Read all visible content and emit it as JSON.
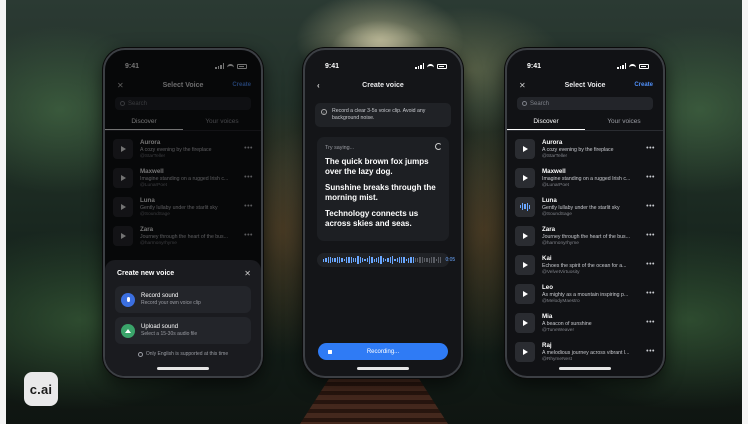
{
  "logo": {
    "text": "c.ai"
  },
  "status": {
    "time": "9:41"
  },
  "select_voice": {
    "title": "Select Voice",
    "close_icon": "close-icon",
    "create_label": "Create",
    "search_placeholder": "Search",
    "tabs": [
      {
        "label": "Discover",
        "active": true
      },
      {
        "label": "Your voices",
        "active": false
      }
    ],
    "voices": [
      {
        "name": "Aurora",
        "desc": "A cozy evening by the fireplace",
        "handle": "@StarTeller"
      },
      {
        "name": "Maxwell",
        "desc": "Imagine standing on a rugged Irish c...",
        "handle": "@LunarPoet"
      },
      {
        "name": "Luna",
        "desc": "Gently lullaby under the starlit sky",
        "handle": "@SoundSage"
      },
      {
        "name": "Zara",
        "desc": "Journey through the heart of the bus...",
        "handle": "@harmonyrhyme"
      },
      {
        "name": "Kai",
        "desc": "Echoes the spirit of the ocean for a...",
        "handle": "@VelvetVirtuosity"
      },
      {
        "name": "Leo",
        "desc": "As mighty as a mountain inspiring p...",
        "handle": "@MelodyMaestro"
      },
      {
        "name": "Mia",
        "desc": "A beacon of sunshine",
        "handle": "@TuneWeaver"
      },
      {
        "name": "Raj",
        "desc": "A melodious journey across vibrant l...",
        "handle": "@RhymeNest"
      }
    ]
  },
  "create_sheet": {
    "title": "Create new voice",
    "options": [
      {
        "title": "Record sound",
        "sub": "Record your own voice clip"
      },
      {
        "title": "Upload sound",
        "sub": "Select a 15-30s audio file"
      }
    ],
    "note": "Only English is supported at this time"
  },
  "create_voice": {
    "title": "Create voice",
    "info": "Record a clear 3-5s voice clip. Avoid any background noise.",
    "try_label": "Try saying...",
    "lines": [
      "The quick brown fox jumps over the lazy dog.",
      "Sunshine breaks through the morning mist.",
      "Technology connects us across skies and seas."
    ],
    "player_time": "0:05",
    "button_label": "Recording..."
  },
  "colors": {
    "accent": "#2f7bf5",
    "link": "#4f8ef7",
    "wave_active": "#6aa7ff",
    "green": "#3aa46a"
  }
}
